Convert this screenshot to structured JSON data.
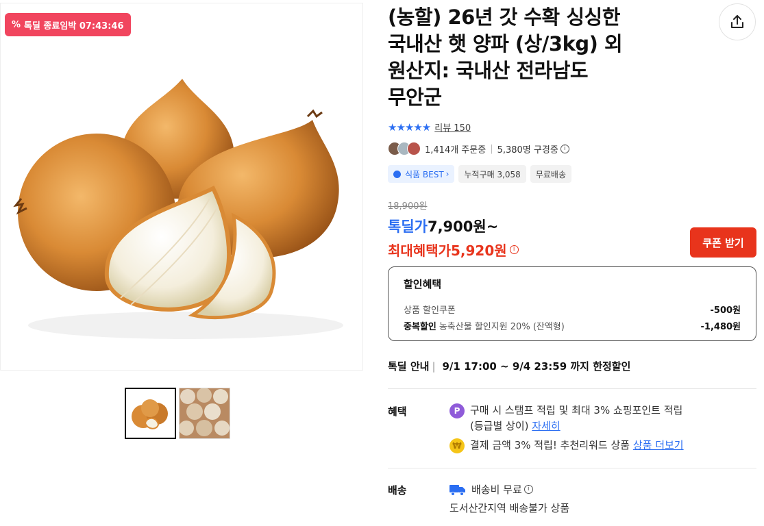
{
  "gallery": {
    "badge_icon": "percent-icon",
    "badge_label": "톡딜 종료임박 07:43:46",
    "thumbnails": [
      "onion-whole-thumb",
      "onion-pile-thumb"
    ]
  },
  "product": {
    "title_line1": "(농할) 26년 갓 수확 싱싱한",
    "title_line2": "국내산 햇 양파 (상/3kg) 외",
    "title_line3": "원산지: 국내산 전라남도",
    "title_line4": "무안군",
    "share_icon": "share-icon",
    "stars": "★★★★★",
    "review_label": "리뷰 150",
    "orders_text": "1,414개 주문중",
    "viewers_text": "5,380명 구경중",
    "tags": [
      "식품 BEST",
      "누적구매 3,058",
      "무료배송"
    ]
  },
  "price": {
    "original": "18,900원",
    "deal_label": "톡딜가",
    "deal_value": "7,900원~",
    "max_label": "최대혜택가",
    "max_value": "5,920원",
    "coupon_button": "쿠폰 받기"
  },
  "discount": {
    "header": "할인혜택",
    "row1_label": "상품 할인쿠폰",
    "row1_value": "-500원",
    "row2_strong": "중복할인",
    "row2_label": "농축산물 할인지원 20% (잔액형)",
    "row2_value": "-1,480원"
  },
  "guide": {
    "label": "톡딜 안내",
    "text": "9/1 17:00 ~ 9/4 23:59 까지 한정할인"
  },
  "benefits": {
    "label": "혜택",
    "item1_text_a": "구매 시 스탬프 적립 및 최대 3% 쇼핑포인트 적립",
    "item1_text_b": "(등급별 상이)",
    "item1_link": "자세히",
    "item2_text": "결제 금액 3% 적립! 추천리워드 상품",
    "item2_link": "상품 더보기"
  },
  "shipping": {
    "label": "배송",
    "fee": "배송비 무료",
    "note": "도서산간지역 배송불가 상품"
  }
}
